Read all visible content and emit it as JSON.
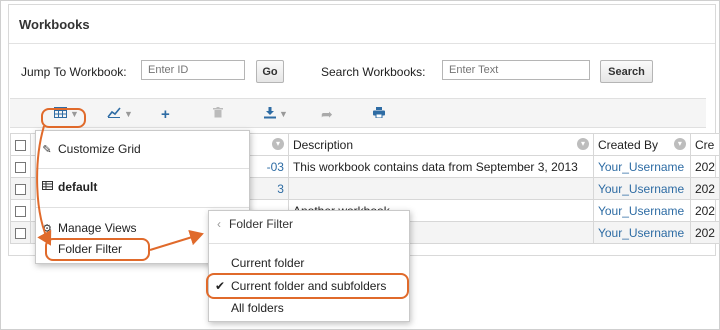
{
  "panel": {
    "title": "Workbooks"
  },
  "jump": {
    "label": "Jump To Workbook:",
    "placeholder": "Enter ID",
    "button": "Go"
  },
  "search": {
    "label": "Search Workbooks:",
    "placeholder": "Enter Text",
    "button": "Search"
  },
  "toolbar": {
    "grid_icon": "grid-icon",
    "chart_icon": "chart-icon",
    "insert_icon": "plus-icon",
    "delete_icon": "trash-icon",
    "export_icon": "download-icon",
    "share_icon": "share-arrow-icon",
    "print_icon": "print-icon"
  },
  "grid": {
    "columns": [
      "Description",
      "Created By",
      "Cre"
    ],
    "rows": [
      {
        "id_frag": "-03",
        "description": "This workbook contains data from September 3, 2013",
        "created_by": "Your_Username",
        "created": "202"
      },
      {
        "id_frag": "3",
        "description": "",
        "created_by": "Your_Username",
        "created": "202"
      },
      {
        "id_frag": "",
        "description": "Another workbook",
        "created_by": "Your_Username",
        "created": "202"
      },
      {
        "id_frag": "",
        "description": "",
        "created_by": "Your_Username",
        "created": "202"
      }
    ]
  },
  "menu": {
    "customize": "Customize Grid",
    "default": "default",
    "manage": "Manage Views",
    "folder_filter": "Folder Filter"
  },
  "submenu": {
    "header": "Folder Filter",
    "current": "Current folder",
    "current_sub": "Current folder and subfolders",
    "all": "All folders"
  },
  "colors": {
    "link": "#2e6ca4",
    "highlight": "#e06a2b"
  }
}
